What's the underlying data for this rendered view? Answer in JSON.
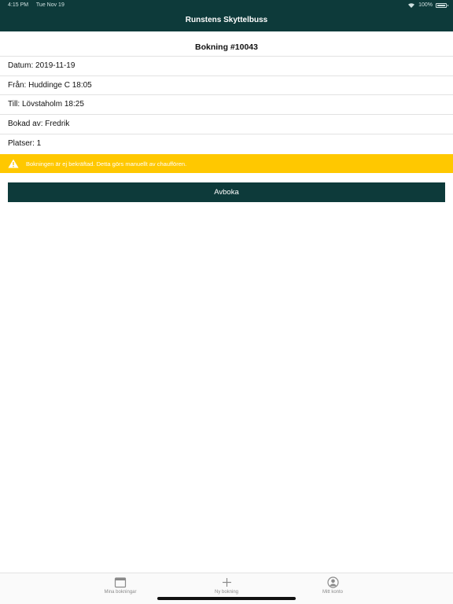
{
  "status_bar": {
    "time": "4:15 PM",
    "date": "Tue Nov 19",
    "battery": "100%"
  },
  "header": {
    "title": "Runstens Skyttelbuss"
  },
  "booking": {
    "title": "Bokning #10043",
    "rows": [
      "Datum: 2019-11-19",
      "Från: Huddinge C 18:05",
      "Till: Lövstaholm 18:25",
      "Bokad av: Fredrik",
      "Platser: 1"
    ]
  },
  "warning": {
    "text": "Bokningen är ej bekräftad. Detta görs manuellt av chauffören.",
    "icon": "warning-triangle-icon",
    "color": "#ffc800"
  },
  "actions": {
    "cancel_label": "Avboka"
  },
  "tabbar": {
    "tabs": [
      {
        "label": "Mina bokningar",
        "icon": "calendar-icon"
      },
      {
        "label": "Ny bokning",
        "icon": "plus-icon"
      },
      {
        "label": "Mitt konto",
        "icon": "account-icon"
      }
    ]
  },
  "colors": {
    "brand": "#0d3a3a",
    "warning": "#ffc800"
  }
}
